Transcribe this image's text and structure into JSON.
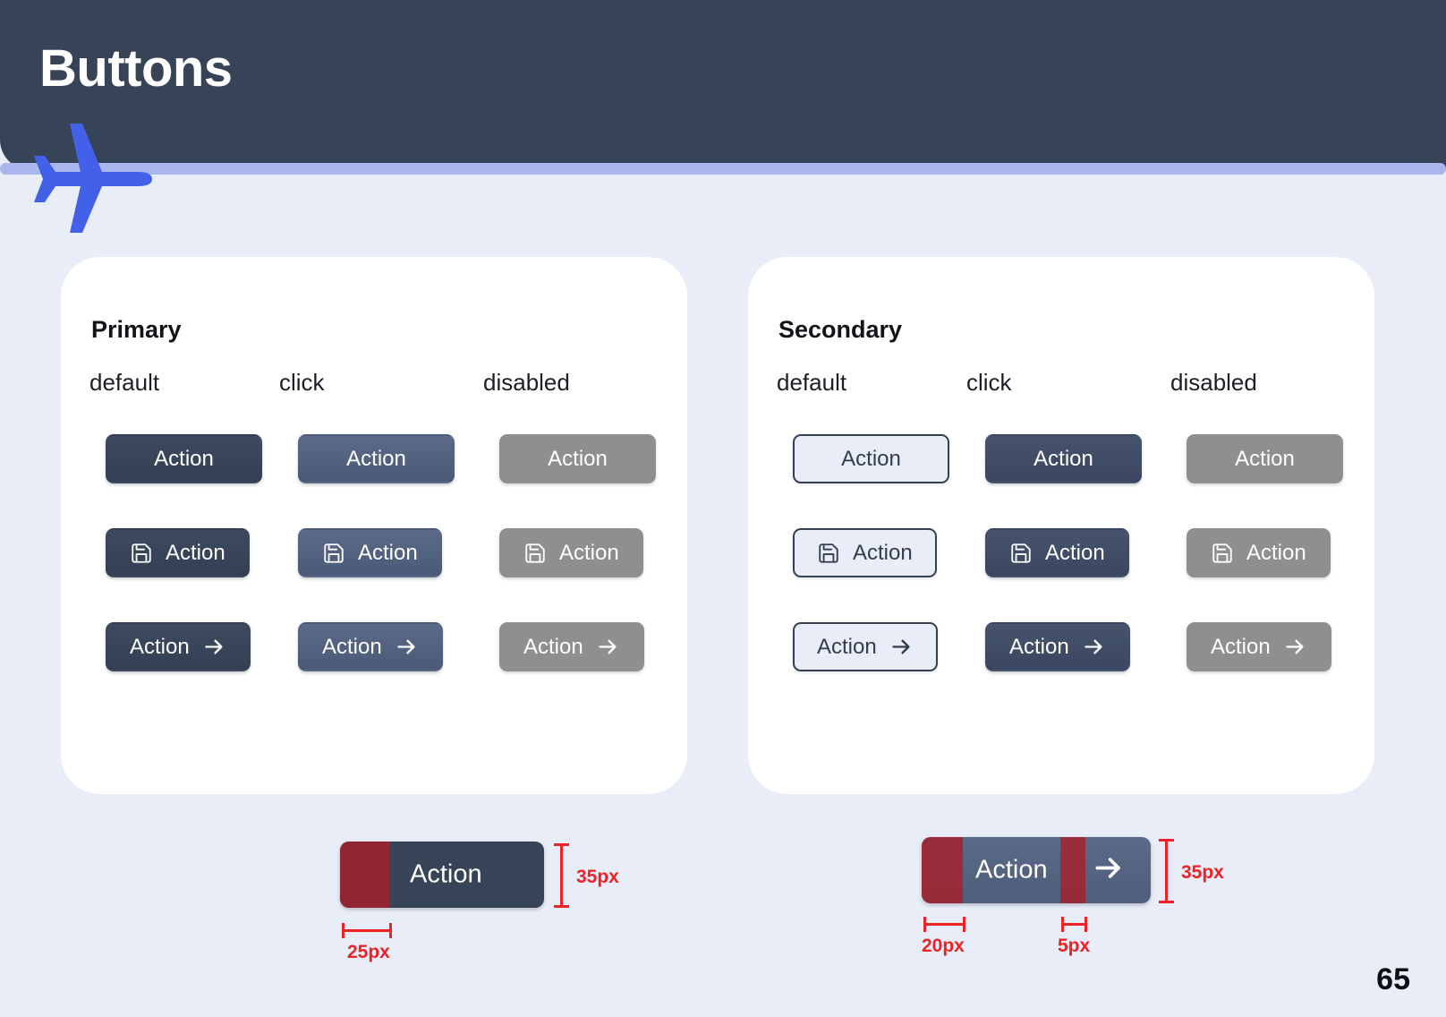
{
  "header": {
    "title": "Buttons",
    "bar_color": "#374357",
    "accent_color": "#4361e8",
    "trail_color": "#aab6ee",
    "plane_icon": "airplane-icon"
  },
  "page": {
    "background": "#e9edf7",
    "number": "65"
  },
  "cards": [
    {
      "title": "Primary",
      "state_labels": [
        "default",
        "click",
        "disabled"
      ],
      "rows": [
        {
          "type": "text",
          "buttons": [
            {
              "label": "Action",
              "state": "default",
              "style": "filled-dark",
              "icon": null
            },
            {
              "label": "Action",
              "state": "click",
              "style": "filled-slate",
              "icon": null
            },
            {
              "label": "Action",
              "state": "disabled",
              "style": "filled-gray",
              "icon": null
            }
          ]
        },
        {
          "type": "icon-text",
          "buttons": [
            {
              "label": "Action",
              "state": "default",
              "style": "filled-dark",
              "icon": "save-icon"
            },
            {
              "label": "Action",
              "state": "click",
              "style": "filled-slate",
              "icon": "save-icon"
            },
            {
              "label": "Action",
              "state": "disabled",
              "style": "filled-gray",
              "icon": "save-icon"
            }
          ]
        },
        {
          "type": "text-arrow",
          "buttons": [
            {
              "label": "Action",
              "state": "default",
              "style": "filled-dark",
              "icon": "arrow-right-icon"
            },
            {
              "label": "Action",
              "state": "click",
              "style": "filled-slate",
              "icon": "arrow-right-icon"
            },
            {
              "label": "Action",
              "state": "disabled",
              "style": "filled-gray",
              "icon": "arrow-right-icon"
            }
          ]
        }
      ]
    },
    {
      "title": "Secondary",
      "state_labels": [
        "default",
        "click",
        "disabled"
      ],
      "rows": [
        {
          "type": "text",
          "buttons": [
            {
              "label": "Action",
              "state": "default",
              "style": "outline",
              "icon": null
            },
            {
              "label": "Action",
              "state": "click",
              "style": "filled-dark",
              "icon": null
            },
            {
              "label": "Action",
              "state": "disabled",
              "style": "filled-gray",
              "icon": null
            }
          ]
        },
        {
          "type": "icon-text",
          "buttons": [
            {
              "label": "Action",
              "state": "default",
              "style": "outline",
              "icon": "save-icon"
            },
            {
              "label": "Action",
              "state": "click",
              "style": "filled-dark",
              "icon": "save-icon"
            },
            {
              "label": "Action",
              "state": "disabled",
              "style": "filled-gray",
              "icon": "save-icon"
            }
          ]
        },
        {
          "type": "text-arrow",
          "buttons": [
            {
              "label": "Action",
              "state": "default",
              "style": "outline",
              "icon": "arrow-right-icon"
            },
            {
              "label": "Action",
              "state": "click",
              "style": "filled-dark",
              "icon": "arrow-right-icon"
            },
            {
              "label": "Action",
              "state": "disabled",
              "style": "filled-gray",
              "icon": "arrow-right-icon"
            }
          ]
        }
      ]
    }
  ],
  "specs": [
    {
      "name": "primary-text-button-spec",
      "button_label": "Action",
      "button_color": "#374357",
      "overlay_color": "#aa1e26",
      "height_label": "35px",
      "padding_label": "25px"
    },
    {
      "name": "primary-arrow-button-spec",
      "button_label": "Action",
      "button_color": "#51607d",
      "overlay_color": "#aa1e26",
      "arrow_icon": "arrow-right-icon",
      "height_label": "35px",
      "padding_label": "20px",
      "gap_label": "5px"
    }
  ],
  "colors": {
    "primary_default": "#374357",
    "primary_click": "#51607d",
    "disabled": "#8f8f8f",
    "secondary_bg": "#e9edf7",
    "secondary_border": "#343f52",
    "annotation_red": "#ec2227",
    "card_bg": "#ffffff"
  }
}
